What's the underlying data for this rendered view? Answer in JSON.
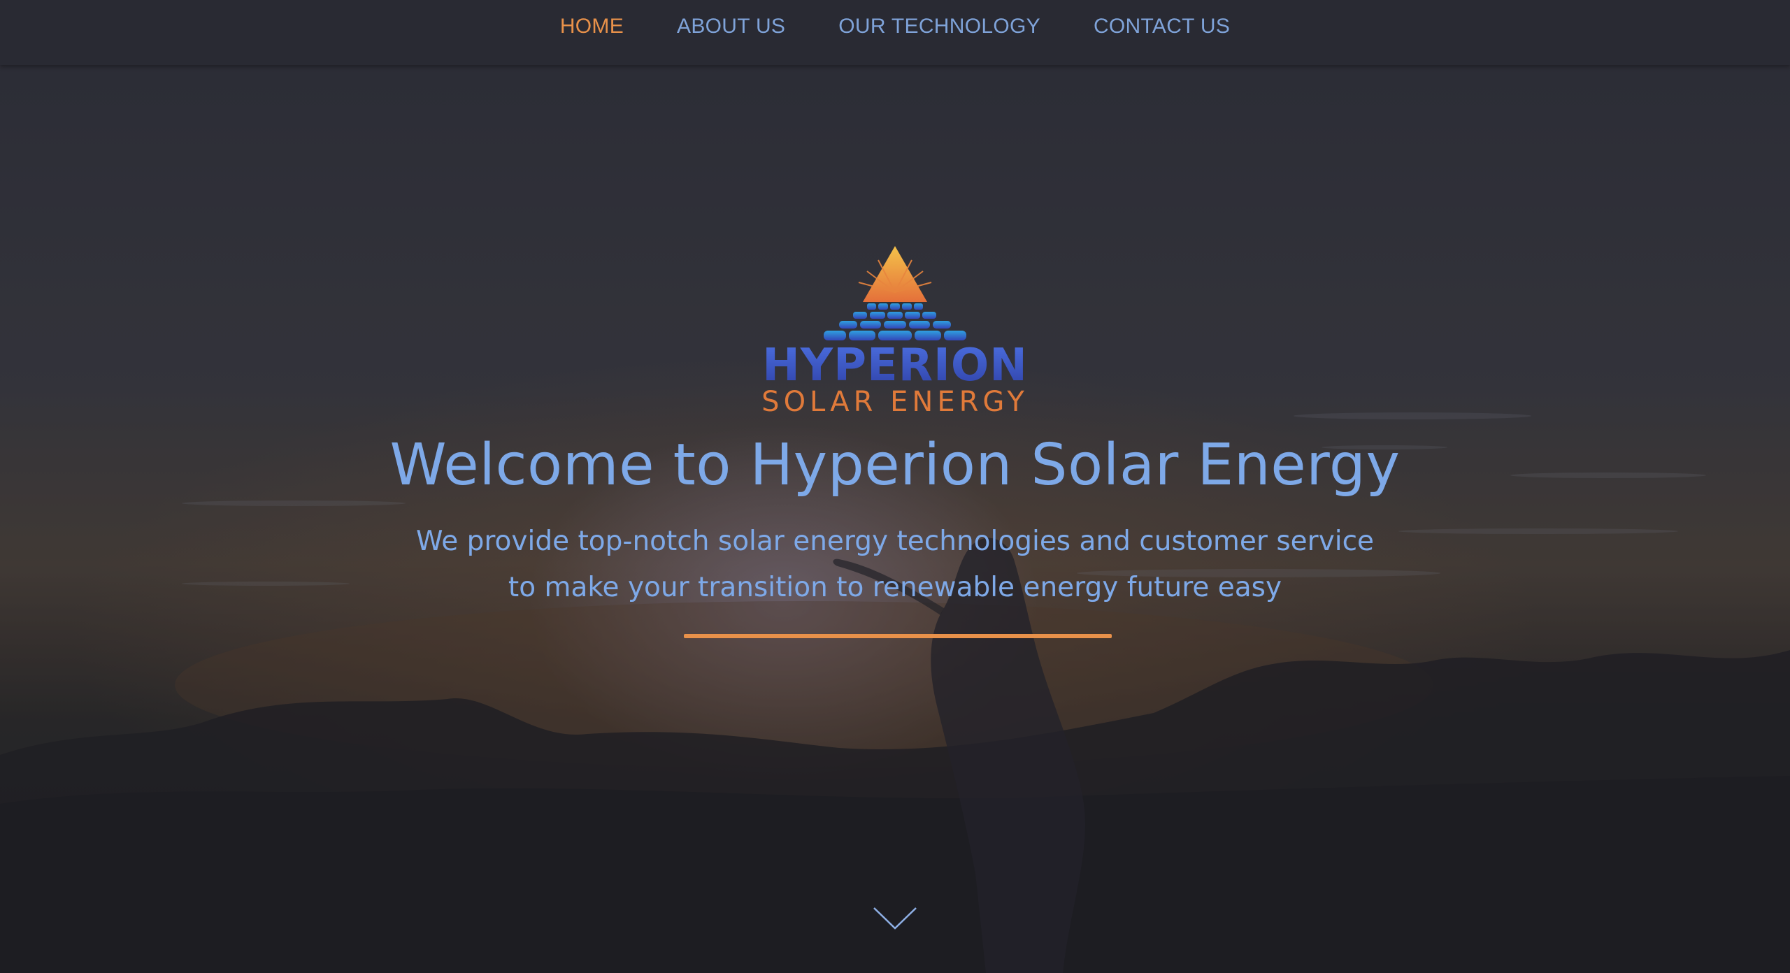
{
  "nav": {
    "items": [
      {
        "label": "HOME",
        "active": true
      },
      {
        "label": "ABOUT US",
        "active": false
      },
      {
        "label": "OUR TECHNOLOGY",
        "active": false
      },
      {
        "label": "CONTACT US",
        "active": false
      }
    ]
  },
  "logo": {
    "word": "HYPERION",
    "tagline": "SOLAR ENERGY"
  },
  "hero": {
    "title": "Welcome to Hyperion Solar Energy",
    "subtitle_line1": "We provide top-notch solar energy technologies and customer service",
    "subtitle_line2": "to make your transition to renewable energy future easy",
    "scroll_icon": "chevron-down-icon"
  },
  "colors": {
    "accent": "#e8914a",
    "text_blue": "#7ea9e8",
    "nav_bg": "#292a33",
    "logo_blue": "#3b58c4",
    "logo_orange": "#e07a3a"
  }
}
